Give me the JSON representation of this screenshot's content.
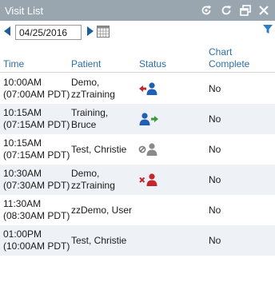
{
  "window": {
    "title": "Visit List"
  },
  "toolbar": {
    "date_value": "04/25/2016"
  },
  "columns": {
    "time": "Time",
    "patient": "Patient",
    "status": "Status",
    "chart_line1": "Chart",
    "chart_line2": "Complete"
  },
  "rows": [
    {
      "time1": "10:00AM",
      "time2": "(07:00AM PDT)",
      "patient1": "Demo,",
      "patient2": "zzTraining",
      "status_icon": "patient-arrow-left-red-icon",
      "chart": "No"
    },
    {
      "time1": "10:15AM",
      "time2": "(07:15AM PDT)",
      "patient1": "Training,",
      "patient2": "Bruce",
      "status_icon": "patient-arrow-right-green-icon",
      "chart": "No"
    },
    {
      "time1": "10:15AM",
      "time2": "(07:15AM PDT)",
      "patient1": "Test, Christie",
      "patient2": "",
      "status_icon": "patient-cancelled-gray-icon",
      "chart": "No"
    },
    {
      "time1": "10:30AM",
      "time2": "(07:30AM PDT)",
      "patient1": "Demo,",
      "patient2": "zzTraining",
      "status_icon": "patient-x-red-icon",
      "chart": "No"
    },
    {
      "time1": "11:30AM",
      "time2": "(08:30AM PDT)",
      "patient1": "zzDemo, User",
      "patient2": "",
      "status_icon": "",
      "chart": "No"
    },
    {
      "time1": "01:00PM",
      "time2": "(10:00AM PDT)",
      "patient1": "Test, Christie",
      "patient2": "",
      "status_icon": "",
      "chart": "No"
    }
  ],
  "colors": {
    "titlebar": "#9aa6af",
    "header_text": "#2f6fa8",
    "alt_row": "#eef2f6",
    "nav_arrow": "#1f5d96"
  }
}
